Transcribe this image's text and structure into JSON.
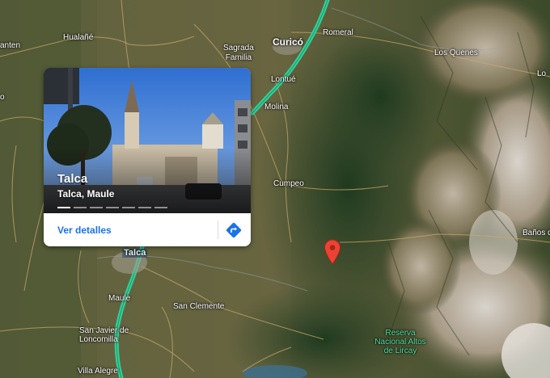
{
  "map": {
    "labels": {
      "anten": "anten",
      "hualane": "Hualañé",
      "curico": "Curicó",
      "romeral": "Romeral",
      "sagrada_familia": "Sagrada\nFamilia",
      "los_quenes": "Los Quenes",
      "lontue": "Lontué",
      "molina": "Molina",
      "cumpeo": "Cumpeo",
      "banos": "Baños de",
      "talca": "Talca",
      "maule": "Maule",
      "san_clemente": "San Clemente",
      "san_javier": "San Javier de\nLoncomilla",
      "villa_alegre": "Villa Alegre",
      "reserva": "Reserva\nNacional Altos\nde Lircay",
      "edge_lo": "Lo",
      "edge_o": "o"
    },
    "colors": {
      "highway": "#2fd39a",
      "pin": "#ea4335",
      "park_label": "#4fe0a2"
    },
    "icons": {
      "pin": "location-pin-icon",
      "directions": "directions-icon"
    }
  },
  "place_card": {
    "title": "Talca",
    "subtitle": "Talca, Maule",
    "details_label": "Ver detalles",
    "photo_count": 7,
    "active_photo": 1
  }
}
